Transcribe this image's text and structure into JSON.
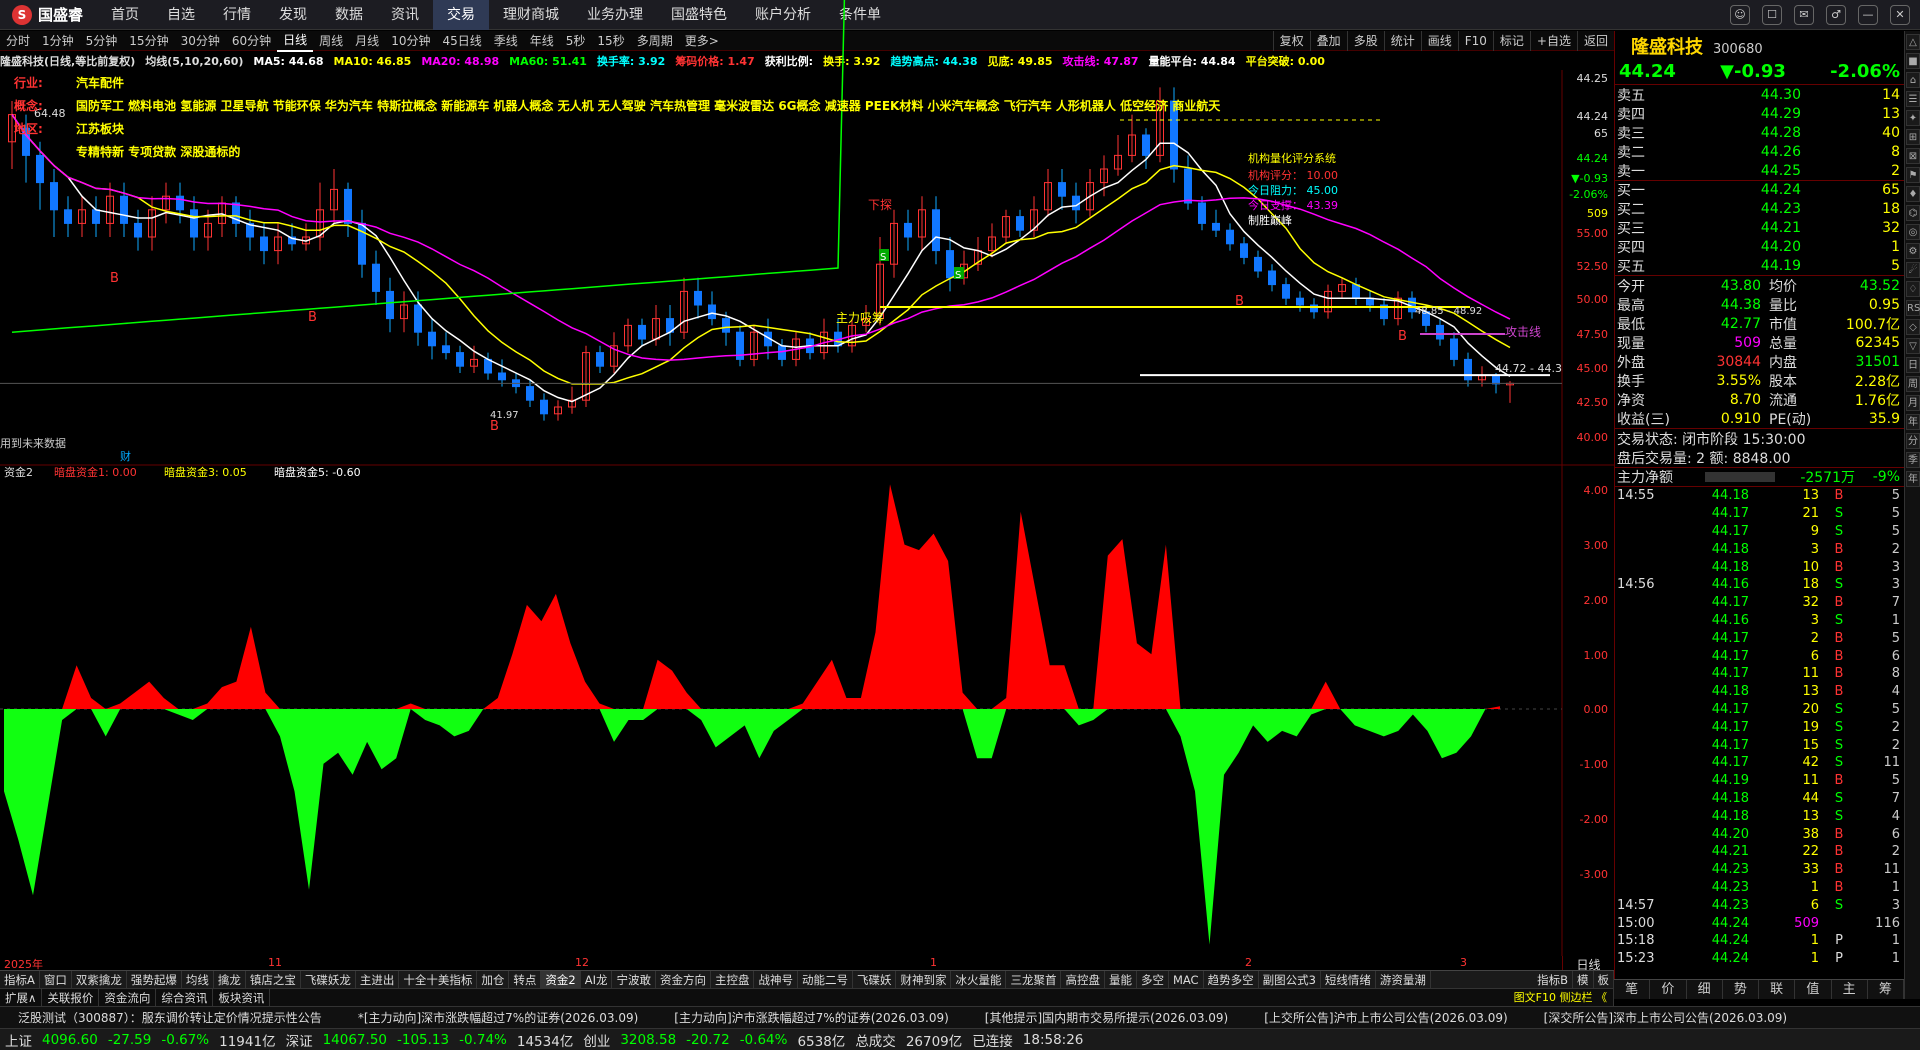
{
  "app": {
    "logo": "国盛睿",
    "menu": [
      "首页",
      "自选",
      "行情",
      "发现",
      "数据",
      "资讯",
      "交易",
      "理财商城",
      "业务办理",
      "国盛特色",
      "账户分析",
      "条件单"
    ],
    "active_menu": "交易",
    "win_buttons": [
      "☺",
      "☐",
      "✉",
      "♂",
      "—",
      "✕"
    ]
  },
  "periods": {
    "items": [
      "分时",
      "1分钟",
      "5分钟",
      "15分钟",
      "30分钟",
      "60分钟",
      "日线",
      "周线",
      "月线",
      "10分钟",
      "45日线",
      "季线",
      "年线",
      "5秒",
      "15秒",
      "多周期",
      "更多>"
    ],
    "active": "日线",
    "tools": [
      "复权",
      "叠加",
      "多股",
      "统计",
      "画线",
      "F10",
      "标记",
      "+自选",
      "返回"
    ]
  },
  "legend": {
    "items": [
      {
        "t": "隆盛科技(日线,等比前复权)",
        "c": "#ddd"
      },
      {
        "t": "均线(5,10,20,60)",
        "c": "#ddd"
      },
      {
        "t": "MA5: 44.68",
        "c": "#fff"
      },
      {
        "t": "MA10: 46.85",
        "c": "#ff0"
      },
      {
        "t": "MA20: 48.98",
        "c": "#f0f"
      },
      {
        "t": "MA60: 51.41",
        "c": "#0f0"
      },
      {
        "t": "换手率: 3.92",
        "c": "#0ff"
      },
      {
        "t": "筹码价格: 1.47",
        "c": "#f33"
      },
      {
        "t": "获利比例:",
        "c": "#fff"
      },
      {
        "t": "换手: 3.92",
        "c": "#ff0"
      },
      {
        "t": "趋势高点: 44.38",
        "c": "#0ff"
      },
      {
        "t": "见底: 49.85",
        "c": "#ff0"
      },
      {
        "t": "攻击线: 47.87",
        "c": "#f0f"
      },
      {
        "t": "量能平台: 44.84",
        "c": "#fff"
      },
      {
        "t": "平台突破: 0.00",
        "c": "#ff0"
      }
    ]
  },
  "info": [
    {
      "k": "行业:",
      "v": "汽车配件"
    },
    {
      "k": "概念:",
      "v": "国防军工 燃料电池 氢能源 卫星导航 节能环保 华为汽车 特斯拉概念 新能源车 机器人概念 无人机 无人驾驶 汽车热管理 毫米波雷达 6G概念 减速器 PEEK材料 小米汽车概念 飞行汽车 人形机器人 低空经济 商业航天"
    },
    {
      "k": "地区:",
      "v": "江苏板块"
    },
    {
      "k": "",
      "v": "专精特新 专项贷款 深股通标的"
    }
  ],
  "chart_annotations": {
    "label_6448": "64.48",
    "future": "用到未来数据",
    "cai": "财",
    "xiafang": "下探",
    "zhuli": "主力吸筹",
    "gongji": "攻击线",
    "b_markers": [
      "B",
      "B",
      "B",
      "B",
      "B"
    ],
    "s_markers": [
      "S",
      "S"
    ],
    "rating_title": "机构量化评分系统",
    "rating_score": "机构评分： 10.00",
    "rating_res": "今日阻力： 45.00",
    "rating_sup": "今日支撑： 43.39",
    "rating_peak": "制胜巅峰",
    "lbl_4472": "44.72 - 44.3",
    "lbl_low": "41.97",
    "lbl_top": "48.85 - 48.92"
  },
  "price_axis": {
    "labels": [
      "44.25",
      "44.24",
      "65",
      "44.24",
      "▼-0.93",
      "-2.06%",
      "509",
      "55.00",
      "52.50",
      "50.00",
      "47.50",
      "45.00",
      "42.50",
      "40.00"
    ]
  },
  "sub_legend": [
    {
      "t": "资金2",
      "c": "#ddd"
    },
    {
      "t": "暗盘资金1: 0.00",
      "c": "#f33"
    },
    {
      "t": "暗盘资金3: 0.05",
      "c": "#ff0"
    },
    {
      "t": "暗盘资金5: -0.60",
      "c": "#fff"
    }
  ],
  "sub_axis": [
    "4.00",
    "3.00",
    "2.00",
    "1.00",
    "0.00",
    "-1.00",
    "-2.00",
    "-3.00"
  ],
  "chart_data": {
    "type": "area",
    "title": "资金2",
    "series": [
      {
        "name": "暗盘资金",
        "values": [
          -1.5,
          -2.4,
          -3.4,
          -1.8,
          -0.2,
          0.8,
          0.2,
          -0.5,
          0.1,
          0.3,
          0.5,
          0.2,
          -0.1,
          -0.2,
          0.1,
          0.4,
          0.5,
          1.5,
          0.3,
          -0.5,
          -1.5,
          -3.3,
          -1.0,
          -0.8,
          -1.2,
          -0.6,
          -1.1,
          -0.9,
          0.1,
          -0.2,
          -0.3,
          -0.5,
          -0.4,
          0.0,
          0.2,
          1.0,
          1.9,
          1.6,
          2.1,
          1.2,
          0.5,
          0.1,
          -0.6,
          -0.2,
          -0.2,
          0.9,
          0.7,
          0.3,
          -0.2,
          -0.7,
          -0.5,
          -0.3,
          -0.9,
          -0.4,
          -0.2,
          0.1,
          0.5,
          0.9,
          0.2,
          0.2,
          1.4,
          4.1,
          3.0,
          2.9,
          3.2,
          2.7,
          0.3,
          -0.9,
          -0.9,
          0.2,
          3.6,
          2.2,
          0.8,
          0.8,
          -0.3,
          -0.2,
          2.8,
          3.1,
          1.2,
          1.0,
          3.0,
          -0.5,
          -1.5,
          -4.3,
          -1.2,
          -0.8,
          -0.3,
          -0.6,
          -0.4,
          -0.5,
          -0.1,
          0.5,
          0.0,
          -0.3,
          -0.4,
          -0.5,
          -0.4,
          -0.1,
          -0.4,
          -0.9,
          -0.8,
          -0.5,
          0.0,
          0.05
        ]
      }
    ],
    "ylim": [
      -4.3,
      4.1
    ]
  },
  "xaxis": {
    "labels": [
      "2025年",
      "11",
      "12",
      "1",
      "2",
      "3"
    ],
    "right": "日线"
  },
  "indicator_tabs": {
    "items": [
      "指标A",
      "窗口",
      "双紫擒龙",
      "强势起爆",
      "均线",
      "擒龙",
      "镇店之宝",
      "飞碟妖龙",
      "主进出",
      "十全十美指标",
      "加仓",
      "转点",
      "资金2",
      "AI龙",
      "宁波敢",
      "资金方向",
      "主控盘",
      "战神号",
      "动能二号",
      "飞碟妖",
      "财神到家",
      "冰火量能",
      "三龙聚首",
      "高控盘",
      "量能",
      "多空",
      "MAC",
      "趋势多空",
      "副图公式3",
      "短线情绪",
      "游资量潮"
    ],
    "active": "资金2",
    "right": [
      "指标B",
      "模",
      "板"
    ]
  },
  "footer_tabs": {
    "items": [
      "扩展∧",
      "关联报价",
      "资金流向",
      "综合资讯",
      "板块资讯"
    ],
    "right": "图文F10 侧边栏 《"
  },
  "stock": {
    "name": "隆盛科技",
    "code": "300680",
    "price": "44.24",
    "change": "▼-0.93",
    "pct": "-2.06%"
  },
  "orderbook": [
    {
      "l": "卖五",
      "p": "44.30",
      "v": "14"
    },
    {
      "l": "卖四",
      "p": "44.29",
      "v": "13"
    },
    {
      "l": "卖三",
      "p": "44.28",
      "v": "40"
    },
    {
      "l": "卖二",
      "p": "44.26",
      "v": "8"
    },
    {
      "l": "卖一",
      "p": "44.25",
      "v": "2"
    },
    {
      "l": "买一",
      "p": "44.24",
      "v": "65"
    },
    {
      "l": "买二",
      "p": "44.23",
      "v": "18"
    },
    {
      "l": "买三",
      "p": "44.21",
      "v": "32"
    },
    {
      "l": "买四",
      "p": "44.20",
      "v": "1"
    },
    {
      "l": "买五",
      "p": "44.19",
      "v": "5"
    }
  ],
  "stats": [
    {
      "l1": "今开",
      "v1": "43.80",
      "c1": "#0f0",
      "l2": "均价",
      "v2": "43.52",
      "c2": "#0f0"
    },
    {
      "l1": "最高",
      "v1": "44.38",
      "c1": "#0f0",
      "l2": "量比",
      "v2": "0.95",
      "c2": "#ff0"
    },
    {
      "l1": "最低",
      "v1": "42.77",
      "c1": "#0f0",
      "l2": "市值",
      "v2": "100.7亿",
      "c2": "#ff0"
    },
    {
      "l1": "现量",
      "v1": "509",
      "c1": "#f0f",
      "l2": "总量",
      "v2": "62345",
      "c2": "#ff0"
    },
    {
      "l1": "外盘",
      "v1": "30844",
      "c1": "#f33",
      "l2": "内盘",
      "v2": "31501",
      "c2": "#0f0"
    },
    {
      "l1": "换手",
      "v1": "3.55%",
      "c1": "#ff0",
      "l2": "股本",
      "v2": "2.28亿",
      "c2": "#ff0"
    },
    {
      "l1": "净资",
      "v1": "8.70",
      "c1": "#ff0",
      "l2": "流通",
      "v2": "1.76亿",
      "c2": "#ff0"
    },
    {
      "l1": "收益(三)",
      "v1": "0.910",
      "c1": "#ff0",
      "l2": "PE(动)",
      "v2": "35.9",
      "c2": "#ff0"
    }
  ],
  "status": {
    "state": "交易状态: 闭市阶段 15:30:00",
    "after": "盘后交易量: 2  额: 8848.00"
  },
  "flow": {
    "label": "主力净额",
    "value": "-2571万",
    "pct": "-9%"
  },
  "ticks": [
    {
      "t": "14:55",
      "p": "44.18",
      "v": "13",
      "s": "B",
      "n": "5"
    },
    {
      "t": "",
      "p": "44.17",
      "v": "21",
      "s": "S",
      "n": "5"
    },
    {
      "t": "",
      "p": "44.17",
      "v": "9",
      "s": "S",
      "n": "5"
    },
    {
      "t": "",
      "p": "44.18",
      "v": "3",
      "s": "B",
      "n": "2"
    },
    {
      "t": "",
      "p": "44.18",
      "v": "10",
      "s": "B",
      "n": "3"
    },
    {
      "t": "14:56",
      "p": "44.16",
      "v": "18",
      "s": "S",
      "n": "3"
    },
    {
      "t": "",
      "p": "44.17",
      "v": "32",
      "s": "B",
      "n": "7"
    },
    {
      "t": "",
      "p": "44.16",
      "v": "3",
      "s": "S",
      "n": "1"
    },
    {
      "t": "",
      "p": "44.17",
      "v": "2",
      "s": "B",
      "n": "5"
    },
    {
      "t": "",
      "p": "44.17",
      "v": "6",
      "s": "B",
      "n": "6"
    },
    {
      "t": "",
      "p": "44.17",
      "v": "11",
      "s": "B",
      "n": "8"
    },
    {
      "t": "",
      "p": "44.18",
      "v": "13",
      "s": "B",
      "n": "4"
    },
    {
      "t": "",
      "p": "44.17",
      "v": "20",
      "s": "S",
      "n": "5"
    },
    {
      "t": "",
      "p": "44.17",
      "v": "19",
      "s": "S",
      "n": "2"
    },
    {
      "t": "",
      "p": "44.17",
      "v": "15",
      "s": "S",
      "n": "2"
    },
    {
      "t": "",
      "p": "44.17",
      "v": "42",
      "s": "S",
      "n": "11"
    },
    {
      "t": "",
      "p": "44.19",
      "v": "11",
      "s": "B",
      "n": "5"
    },
    {
      "t": "",
      "p": "44.18",
      "v": "44",
      "s": "S",
      "n": "7"
    },
    {
      "t": "",
      "p": "44.18",
      "v": "13",
      "s": "S",
      "n": "4"
    },
    {
      "t": "",
      "p": "44.20",
      "v": "38",
      "s": "B",
      "n": "6"
    },
    {
      "t": "",
      "p": "44.21",
      "v": "22",
      "s": "B",
      "n": "2"
    },
    {
      "t": "",
      "p": "44.23",
      "v": "33",
      "s": "B",
      "n": "11"
    },
    {
      "t": "",
      "p": "44.23",
      "v": "1",
      "s": "B",
      "n": "1"
    },
    {
      "t": "14:57",
      "p": "44.23",
      "v": "6",
      "s": "S",
      "n": "3"
    },
    {
      "t": "15:00",
      "p": "44.24",
      "v": "509",
      "s": "",
      "n": "116"
    },
    {
      "t": "15:18",
      "p": "44.24",
      "v": "1",
      "s": "P",
      "n": "1"
    },
    {
      "t": "15:23",
      "p": "44.24",
      "v": "1",
      "s": "P",
      "n": "1"
    }
  ],
  "sidebar_tabs": [
    "笔",
    "价",
    "细",
    "势",
    "联",
    "值",
    "主",
    "筹"
  ],
  "right_strip": [
    "△",
    "■",
    "⌂",
    "☰",
    "✦",
    "⊞",
    "⊠",
    "⚑",
    "♦",
    "⌬",
    "◎",
    "⚙",
    "☄",
    "♢",
    "RSI",
    "◇",
    "▽",
    "日",
    "周",
    "月",
    "年",
    "分",
    "季",
    "年"
  ],
  "news": [
    "泛股测试（300887）：服东调价转让定价情况提示性公告",
    "*[主力动向]深市涨跌幅超过7%的证券(2026.03.09)",
    "[主力动向]沪市涨跌幅超过7%的证券(2026.03.09)",
    "[其他提示]国内期市交易所提示(2026.03.09)",
    "[上交所公告]沪市上市公司公告(2026.03.09)",
    "[深交所公告]深市上市公司公告(2026.03.09)"
  ],
  "statusbar": [
    {
      "t": "上证",
      "c": "#ddd"
    },
    {
      "t": "4096.60",
      "c": "#0f0"
    },
    {
      "t": "-27.59",
      "c": "#0f0"
    },
    {
      "t": "-0.67%",
      "c": "#0f0"
    },
    {
      "t": "11941亿",
      "c": "#ddd"
    },
    {
      "t": "深证",
      "c": "#ddd"
    },
    {
      "t": "14067.50",
      "c": "#0f0"
    },
    {
      "t": "-105.13",
      "c": "#0f0"
    },
    {
      "t": "-0.74%",
      "c": "#0f0"
    },
    {
      "t": "14534亿",
      "c": "#ddd"
    },
    {
      "t": "创业",
      "c": "#ddd"
    },
    {
      "t": "3208.58",
      "c": "#0f0"
    },
    {
      "t": "-20.72",
      "c": "#0f0"
    },
    {
      "t": "-0.64%",
      "c": "#0f0"
    },
    {
      "t": "6538亿",
      "c": "#ddd"
    },
    {
      "t": "总成交",
      "c": "#ddd"
    },
    {
      "t": "26709亿",
      "c": "#ddd"
    },
    {
      "t": "已连接",
      "c": "#ddd"
    },
    {
      "t": "18:58:26",
      "c": "#ddd"
    }
  ]
}
